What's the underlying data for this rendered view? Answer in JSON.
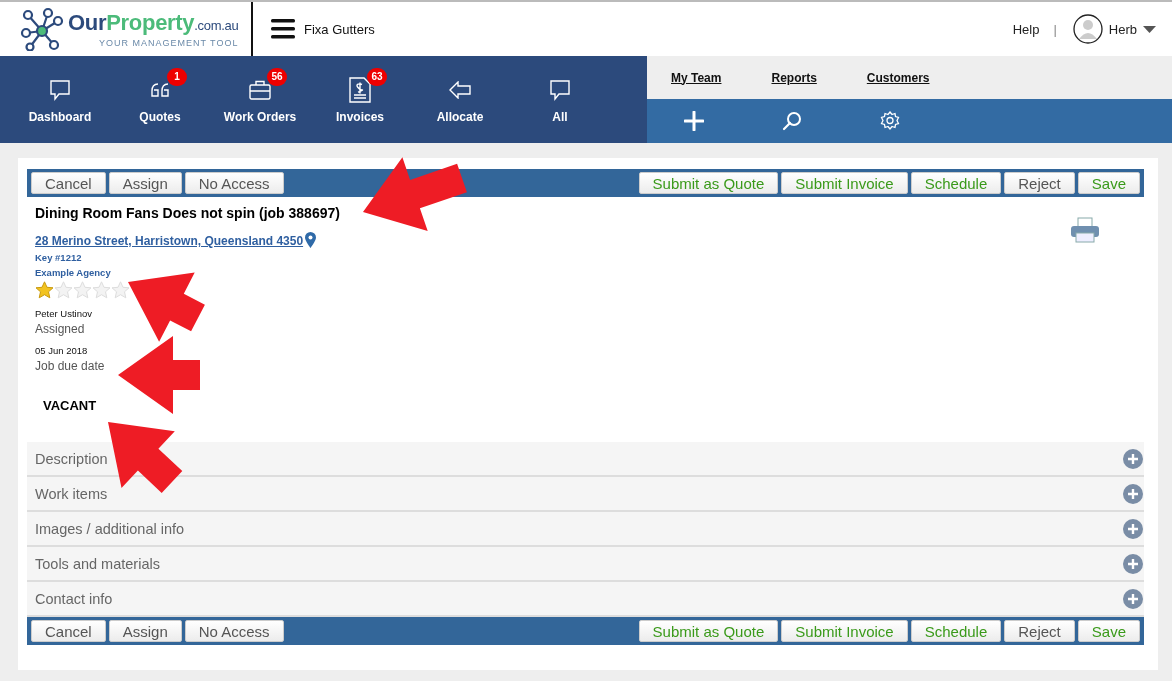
{
  "header": {
    "logo": {
      "brand_dark": "Our",
      "brand_green": "Property",
      "domain": ".com.au",
      "tagline": "YOUR MANAGEMENT TOOL"
    },
    "company": "Fixa Gutters",
    "help": "Help",
    "separator": "|",
    "user": "Herb"
  },
  "nav": [
    {
      "kind": "chat",
      "label": "Dashboard"
    },
    {
      "kind": "quote",
      "label": "Quotes",
      "badge": "1"
    },
    {
      "kind": "briefcase",
      "label": "Work Orders",
      "badge": "56"
    },
    {
      "kind": "invoice",
      "label": "Invoices",
      "badge": "63"
    },
    {
      "kind": "arrow",
      "label": "Allocate"
    },
    {
      "kind": "chat",
      "label": "All"
    }
  ],
  "nav_links": [
    "My Team",
    "Reports",
    "Customers"
  ],
  "quick_actions": [
    {
      "kind": "add"
    },
    {
      "kind": "search"
    },
    {
      "kind": "settings"
    }
  ],
  "toolbars": [
    {
      "left": [
        {
          "label": "Cancel",
          "kind": "plain"
        },
        {
          "label": "Assign",
          "kind": "plain"
        },
        {
          "label": "No Access",
          "kind": "plain"
        }
      ],
      "right": [
        {
          "label": "Submit as Quote",
          "kind": "submit"
        },
        {
          "label": "Submit Invoice",
          "kind": "submit"
        },
        {
          "label": "Schedule",
          "kind": "submit"
        },
        {
          "label": "Reject",
          "kind": "plain"
        },
        {
          "label": "Save",
          "kind": "submit"
        }
      ]
    },
    {
      "left": [
        {
          "label": "Cancel",
          "kind": "plain"
        },
        {
          "label": "Assign",
          "kind": "plain"
        },
        {
          "label": "No Access",
          "kind": "plain"
        }
      ],
      "right": [
        {
          "label": "Submit as Quote",
          "kind": "submit"
        },
        {
          "label": "Submit Invoice",
          "kind": "submit"
        },
        {
          "label": "Schedule",
          "kind": "submit"
        },
        {
          "label": "Reject",
          "kind": "plain"
        },
        {
          "label": "Save",
          "kind": "submit"
        }
      ]
    }
  ],
  "job": {
    "title": "Dining Room Fans Does not spin (job 388697)",
    "address": "28 Merino Street, Harristown, Queensland 4350",
    "key": "Key #1212",
    "agency": "Example Agency",
    "stars": 1,
    "assignee": "Peter  Ustinov",
    "assignee_label": "Assigned",
    "due_date": "05 Jun 2018",
    "due_label": "Job due date",
    "occupancy": "VACANT"
  },
  "sections": [
    {
      "label": "Description",
      "expanded": false
    },
    {
      "label": "Work items",
      "expanded": false
    },
    {
      "label": "Images / additional info",
      "expanded": false
    },
    {
      "label": "Tools and materials",
      "expanded": false
    },
    {
      "label": "Contact info",
      "expanded": false
    }
  ]
}
